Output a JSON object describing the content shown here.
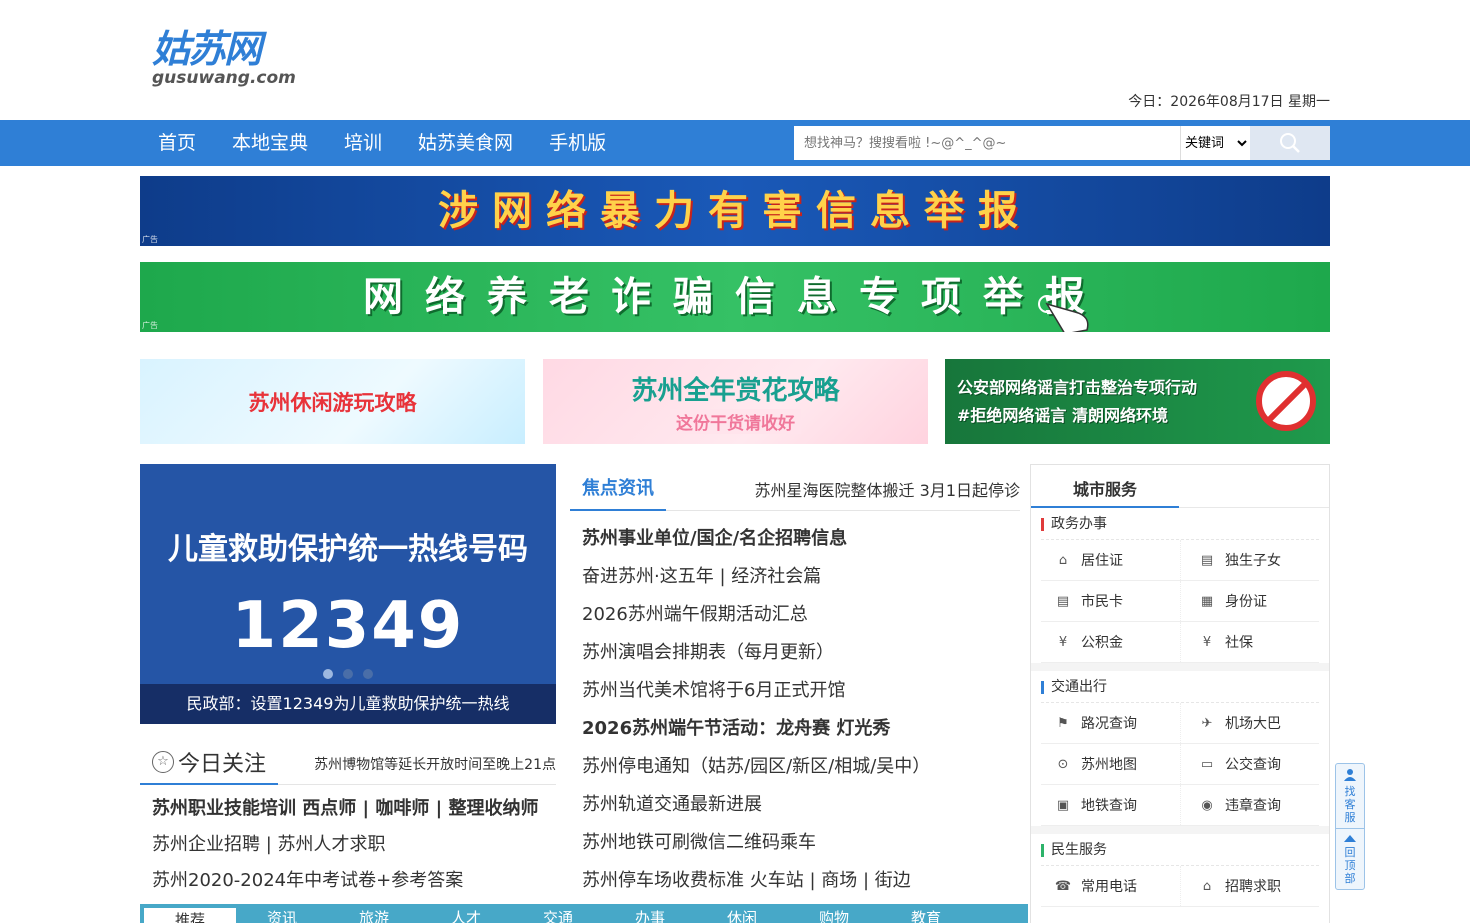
{
  "header": {
    "logo_cn": "姑苏网",
    "logo_en": "gusuwang.com",
    "today": "今日：2026年08月17日 星期一"
  },
  "nav": {
    "items": [
      "首页",
      "本地宝典",
      "培训",
      "姑苏美食网",
      "手机版"
    ]
  },
  "search": {
    "placeholder": "想找神马？搜搜看啦 !~@^_^@~",
    "select_value": "关键词"
  },
  "banners": {
    "b1_text": "涉网络暴力有害信息举报",
    "b2_text": "网络养老诈骗信息专项举报",
    "ad_tag": "广告"
  },
  "promos": {
    "p1": "苏州休闲游玩攻略",
    "p2_line1": "苏州全年赏花攻略",
    "p2_line2": "这份干货请收好",
    "p3_line1": "公安部网络谣言打击整治专项行动",
    "p3_line2": "#拒绝网络谣言 清朗网络环境"
  },
  "slider": {
    "title": "儿童救助保护统一热线号码",
    "number": "12349",
    "caption": "民政部：设置12349为儿童救助保护统一热线"
  },
  "today_focus": {
    "title": "今日关注",
    "marquee": "苏州博物馆等延长开放时间至晚上21点",
    "items": [
      {
        "text": "苏州职业技能培训 西点师 | 咖啡师 | 整理收纳师",
        "bold": true
      },
      {
        "text": "苏州企业招聘 | 苏州人才求职",
        "bold": false
      },
      {
        "text": "苏州2020-2024年中考试卷+参考答案",
        "bold": false
      }
    ]
  },
  "focus": {
    "title": "焦点资讯",
    "marquee": "苏州星海医院整体搬迁 3月1日起停诊",
    "items": [
      {
        "text": "苏州事业单位/国企/名企招聘信息",
        "bold": true
      },
      {
        "text": "奋进苏州·这五年 | 经济社会篇",
        "bold": false
      },
      {
        "text": "2026苏州端午假期活动汇总",
        "bold": false
      },
      {
        "text": "苏州演唱会排期表（每月更新）",
        "bold": false
      },
      {
        "text": "苏州当代美术馆将于6月正式开馆",
        "bold": false
      },
      {
        "text": "2026苏州端午节活动：龙舟赛 灯光秀",
        "bold": true
      },
      {
        "text": "苏州停电通知（姑苏/园区/新区/相城/吴中）",
        "bold": false
      },
      {
        "text": "苏州轨道交通最新进展",
        "bold": false
      },
      {
        "text": "苏州地铁可刷微信二维码乘车",
        "bold": false
      },
      {
        "text": "苏州停车场收费标准 火车站 | 商场 | 街边",
        "bold": false
      }
    ]
  },
  "city": {
    "title": "城市服务",
    "groups": [
      {
        "title": "政务办事",
        "items": [
          {
            "label": "居住证",
            "icon": "house-icon",
            "glyph": "⌂"
          },
          {
            "label": "独生子女",
            "icon": "id-card-icon",
            "glyph": "▤"
          },
          {
            "label": "市民卡",
            "icon": "citizen-card-icon",
            "glyph": "▤"
          },
          {
            "label": "身份证",
            "icon": "identity-card-icon",
            "glyph": "▦"
          },
          {
            "label": "公积金",
            "icon": "fund-icon",
            "glyph": "¥"
          },
          {
            "label": "社保",
            "icon": "social-security-icon",
            "glyph": "¥"
          }
        ]
      },
      {
        "title": "交通出行",
        "items": [
          {
            "label": "路况查询",
            "icon": "road-sign-icon",
            "glyph": "⚑"
          },
          {
            "label": "机场大巴",
            "icon": "airplane-icon",
            "glyph": "✈"
          },
          {
            "label": "苏州地图",
            "icon": "map-pin-icon",
            "glyph": "⊙"
          },
          {
            "label": "公交查询",
            "icon": "bus-icon",
            "glyph": "▭"
          },
          {
            "label": "地铁查询",
            "icon": "metro-icon",
            "glyph": "▣"
          },
          {
            "label": "违章查询",
            "icon": "traffic-icon",
            "glyph": "◉"
          }
        ]
      },
      {
        "title": "民生服务",
        "items": [
          {
            "label": "常用电话",
            "icon": "phone-icon",
            "glyph": "☎"
          },
          {
            "label": "招聘求职",
            "icon": "job-icon",
            "glyph": "⌂"
          }
        ]
      }
    ]
  },
  "tabs": [
    "推荐",
    "资讯",
    "旅游",
    "人才",
    "交通",
    "办事",
    "休闲",
    "购物",
    "教育"
  ],
  "float": {
    "service": "找客服",
    "top": "回顶部"
  },
  "colors": {
    "brand_blue": "#2f7fd6",
    "tab_bar": "#47a8c8"
  }
}
